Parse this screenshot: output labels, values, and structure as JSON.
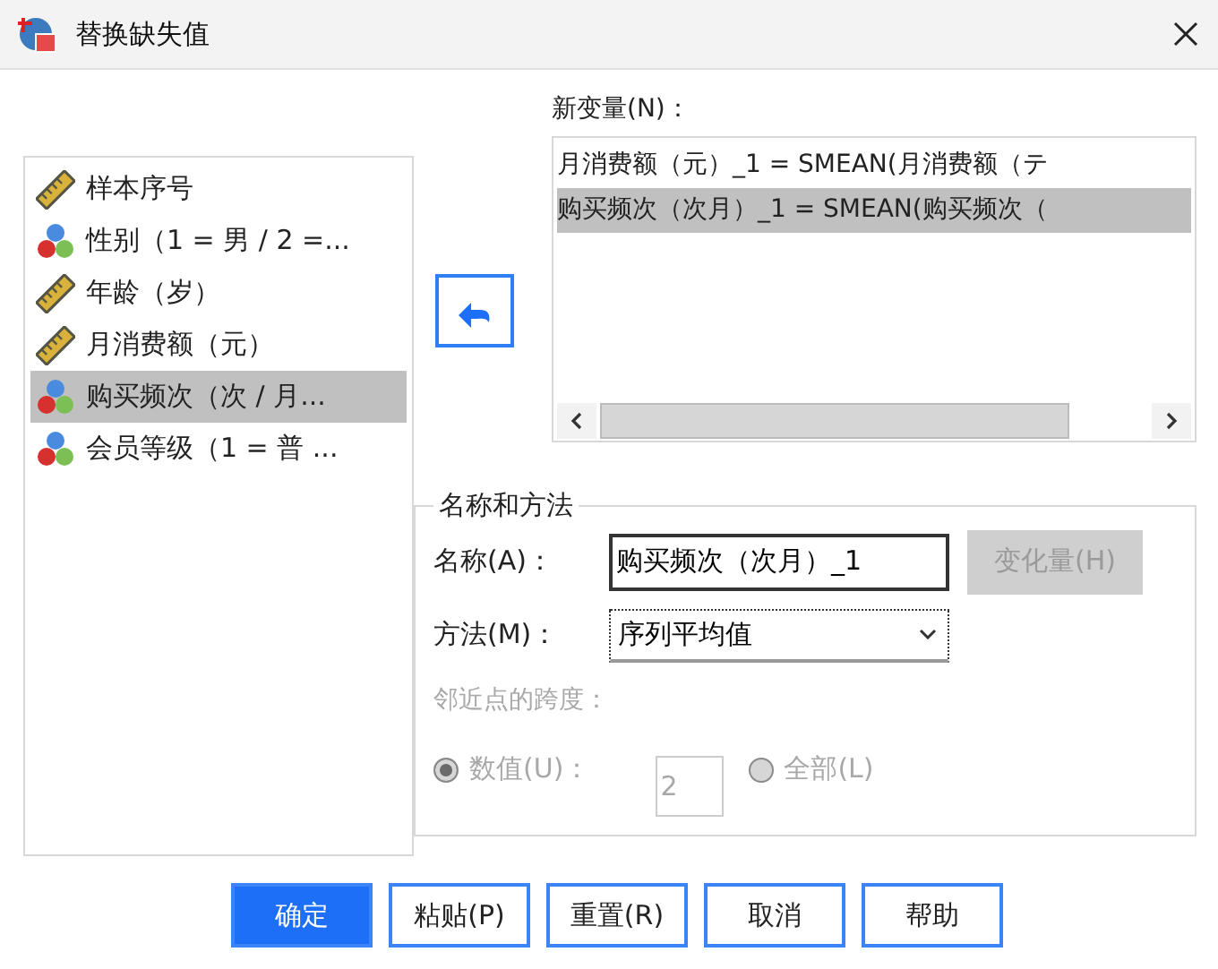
{
  "window": {
    "title": "替换缺失值"
  },
  "variables": [
    {
      "label": "样本序号",
      "kind": "scale",
      "selected": false
    },
    {
      "label": "性别（1 = 男 / 2 =...",
      "kind": "nominal",
      "selected": false
    },
    {
      "label": "年龄（岁）",
      "kind": "scale",
      "selected": false
    },
    {
      "label": "月消费额（元）",
      "kind": "scale",
      "selected": false
    },
    {
      "label": "购买频次（次 / 月...",
      "kind": "nominal",
      "selected": true
    },
    {
      "label": "会员等级（1 = 普 ...",
      "kind": "nominal",
      "selected": false
    }
  ],
  "new_variables": {
    "label": "新变量(N)：",
    "items": [
      {
        "text": "月消费额（元）_1 = SMEAN(月消费额（テ",
        "selected": false
      },
      {
        "text": "购买频次（次月）_1 = SMEAN(购买频次（",
        "selected": true
      }
    ]
  },
  "name_and_method": {
    "legend": "名称和方法",
    "name_label": "名称(A)：",
    "name_value": "购买频次（次月）_1",
    "change_button": {
      "label": "变化量(H)",
      "disabled": true
    },
    "method_label": "方法(M)：",
    "method_value": "序列平均值",
    "span_label": "邻近点的跨度：",
    "span_options": [
      {
        "label": "数值(U)：",
        "selected": true
      },
      {
        "label": "全部(L)",
        "selected": false
      }
    ],
    "span_value": "2",
    "span_disabled": true
  },
  "buttons": [
    {
      "label": "确定",
      "primary": true
    },
    {
      "label": "粘贴(P)",
      "primary": false
    },
    {
      "label": "重置(R)",
      "primary": false
    },
    {
      "label": "取消",
      "primary": false
    },
    {
      "label": "帮助",
      "primary": false
    }
  ]
}
